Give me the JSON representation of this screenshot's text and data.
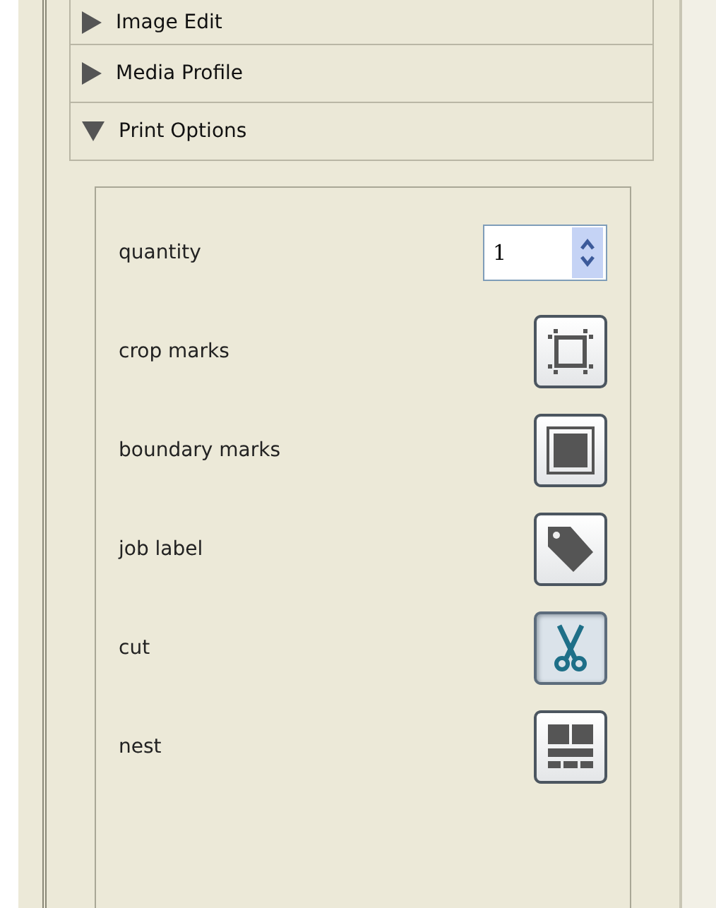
{
  "sections": [
    {
      "title": "Image Edit",
      "expanded": false
    },
    {
      "title": "Media Profile",
      "expanded": false
    },
    {
      "title": "Print Options",
      "expanded": true
    }
  ],
  "options": [
    {
      "kind": "spinner",
      "label": "quantity",
      "value": "1"
    },
    {
      "kind": "toggle",
      "label": "crop marks",
      "on": false
    },
    {
      "kind": "toggle",
      "label": "boundary marks",
      "on": false
    },
    {
      "kind": "toggle",
      "label": "job label",
      "on": false
    },
    {
      "kind": "toggle",
      "label": "cut",
      "on": true
    },
    {
      "kind": "toggle",
      "label": "nest",
      "on": false
    }
  ]
}
